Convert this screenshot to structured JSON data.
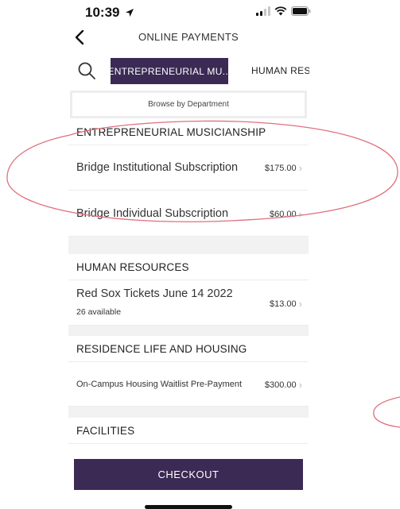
{
  "status_bar": {
    "time": "10:39"
  },
  "nav": {
    "title": "ONLINE PAYMENTS"
  },
  "tabs": [
    {
      "label": "ENTREPRENEURIAL MU...",
      "active": true
    },
    {
      "label": "HUMAN RES",
      "active": false
    }
  ],
  "browse": {
    "label": "Browse by Department"
  },
  "departments": [
    {
      "title": "ENTREPRENEURIAL MUSICIANSHIP",
      "items": [
        {
          "name": "Bridge Institutional Subscription",
          "price": "$175.00"
        },
        {
          "name": "Bridge Individual Subscription",
          "price": "$60.00"
        }
      ]
    },
    {
      "title": "HUMAN RESOURCES",
      "items": [
        {
          "name": "Red Sox Tickets June 14 2022",
          "sub": "26 available",
          "price": "$13.00"
        }
      ]
    },
    {
      "title": "RESIDENCE LIFE AND HOUSING",
      "items": [
        {
          "name": "On-Campus Housing Waitlist Pre-Payment",
          "price": "$300.00"
        }
      ]
    },
    {
      "title": "FACILITIES",
      "items": []
    }
  ],
  "checkout": {
    "label": "CHECKOUT"
  },
  "colors": {
    "accent": "#3b2a54",
    "annotation": "#e0707c"
  },
  "icons": [
    "location-arrow-icon",
    "signal-icon",
    "wifi-icon",
    "battery-icon",
    "back-chevron-icon",
    "search-icon",
    "chevron-right-icon"
  ]
}
